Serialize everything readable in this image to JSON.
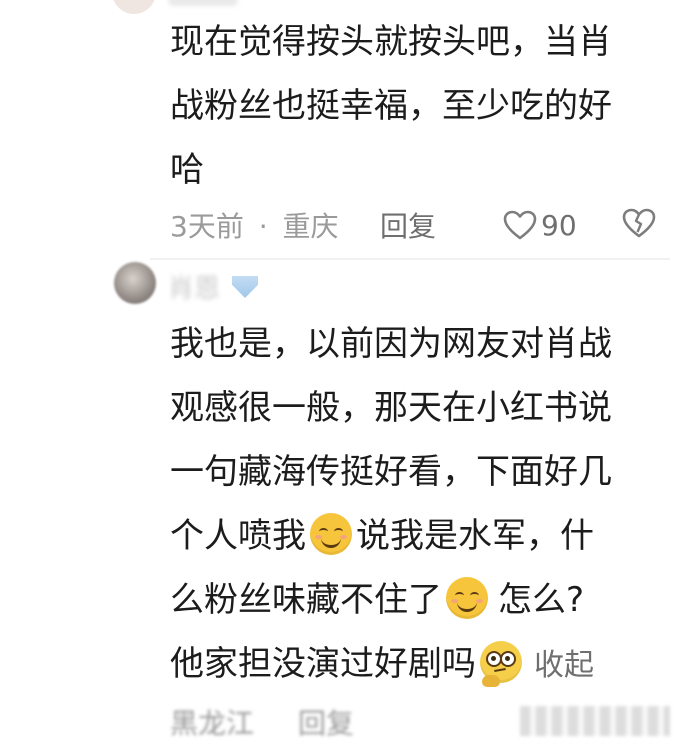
{
  "comment1": {
    "lines": [
      "现在觉得按头就按头吧，当肖",
      "战粉丝也挺幸福，至少吃的好",
      "哈"
    ],
    "time": "3天前",
    "dot": "·",
    "location": "重庆",
    "reply_label": "回复",
    "like_count": "90",
    "like_icon": "heart-outline-icon",
    "dislike_icon": "broken-heart-icon"
  },
  "comment2": {
    "username": "肖恩",
    "line1": "我也是，以前因为网友对肖战",
    "line2": "观感很一般，那天在小红书说",
    "line3": "一句藏海传挺好看，下面好几",
    "line4_a": "个人喷我",
    "line4_b": "说我是水军，什",
    "line5_a": "么粉丝味藏不住了",
    "line5_b": "怎么?",
    "line6_a": "他家担没演过好剧吗",
    "collapse_label": "收起",
    "location": "黑龙江",
    "reply_label": "回复",
    "emojis": [
      "smile-emoji",
      "smile-emoji",
      "thinking-emoji"
    ]
  },
  "colors": {
    "text": "#1c1c1c",
    "meta": "#9a9a9a",
    "background": "#ffffff"
  }
}
